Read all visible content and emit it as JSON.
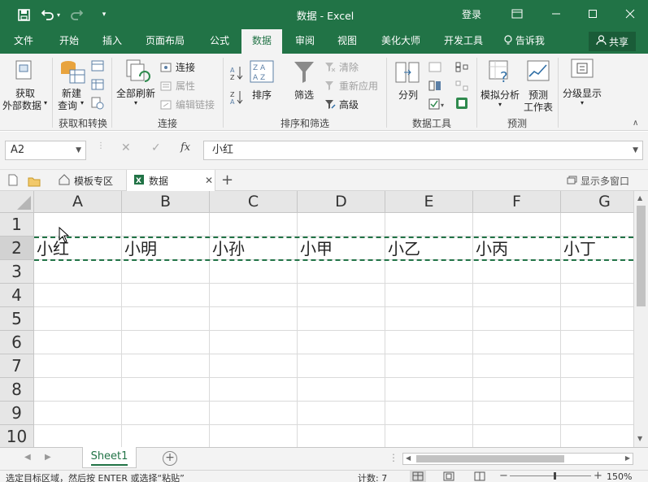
{
  "titlebar": {
    "title": "数据  -  Excel",
    "login": "登录",
    "icons": [
      "save-icon",
      "undo-icon",
      "redo-icon",
      "customize-qat-icon",
      "ribbon-display-icon",
      "minimize-icon",
      "restore-icon",
      "close-icon"
    ]
  },
  "tabs": [
    {
      "label": "文件"
    },
    {
      "label": "开始"
    },
    {
      "label": "插入"
    },
    {
      "label": "页面布局"
    },
    {
      "label": "公式"
    },
    {
      "label": "数据",
      "active": true
    },
    {
      "label": "审阅"
    },
    {
      "label": "视图"
    },
    {
      "label": "美化大师"
    },
    {
      "label": "开发工具"
    }
  ],
  "tell_me": "告诉我",
  "share": "共享",
  "ribbon": {
    "get_external_data": [
      "获取",
      "外部数据"
    ],
    "new_query": [
      "新建",
      "查询"
    ],
    "group_get_transform": "获取和转换",
    "refresh_all": "全部刷新",
    "connections": "连接",
    "properties": "属性",
    "edit_links": "编辑链接",
    "group_connections": "连接",
    "sort": "排序",
    "filter": "筛选",
    "clear": "清除",
    "reapply": "重新应用",
    "advanced": "高级",
    "group_sort_filter": "排序和筛选",
    "text_to_columns": "分列",
    "group_data_tools": "数据工具",
    "what_if": "模拟分析",
    "forecast_sheet": [
      "预测",
      "工作表"
    ],
    "group_forecast": "预测",
    "outline": "分级显示"
  },
  "formula_bar": {
    "name_box": "A2",
    "fx": "fx",
    "value": "小红"
  },
  "doc_tabs": {
    "template_zone": "模板专区",
    "workbook": "数据",
    "multi_window": "显示多窗口"
  },
  "grid": {
    "columns": [
      "A",
      "B",
      "C",
      "D",
      "E",
      "F",
      "G"
    ],
    "rows": [
      "1",
      "2",
      "3",
      "4",
      "5",
      "6",
      "7",
      "8",
      "9",
      "10"
    ],
    "row2_values": [
      "小红",
      "小明",
      "小孙",
      "小甲",
      "小乙",
      "小丙",
      "小丁"
    ]
  },
  "sheet_tab": "Sheet1",
  "status": {
    "message": "选定目标区域，然后按 ENTER 或选择“粘贴”",
    "count": "计数: 7",
    "zoom": "150%"
  },
  "colors": {
    "excel_green": "#217346",
    "ribbon_bg": "#f3f3f3",
    "header_bg": "#e6e6e6"
  }
}
